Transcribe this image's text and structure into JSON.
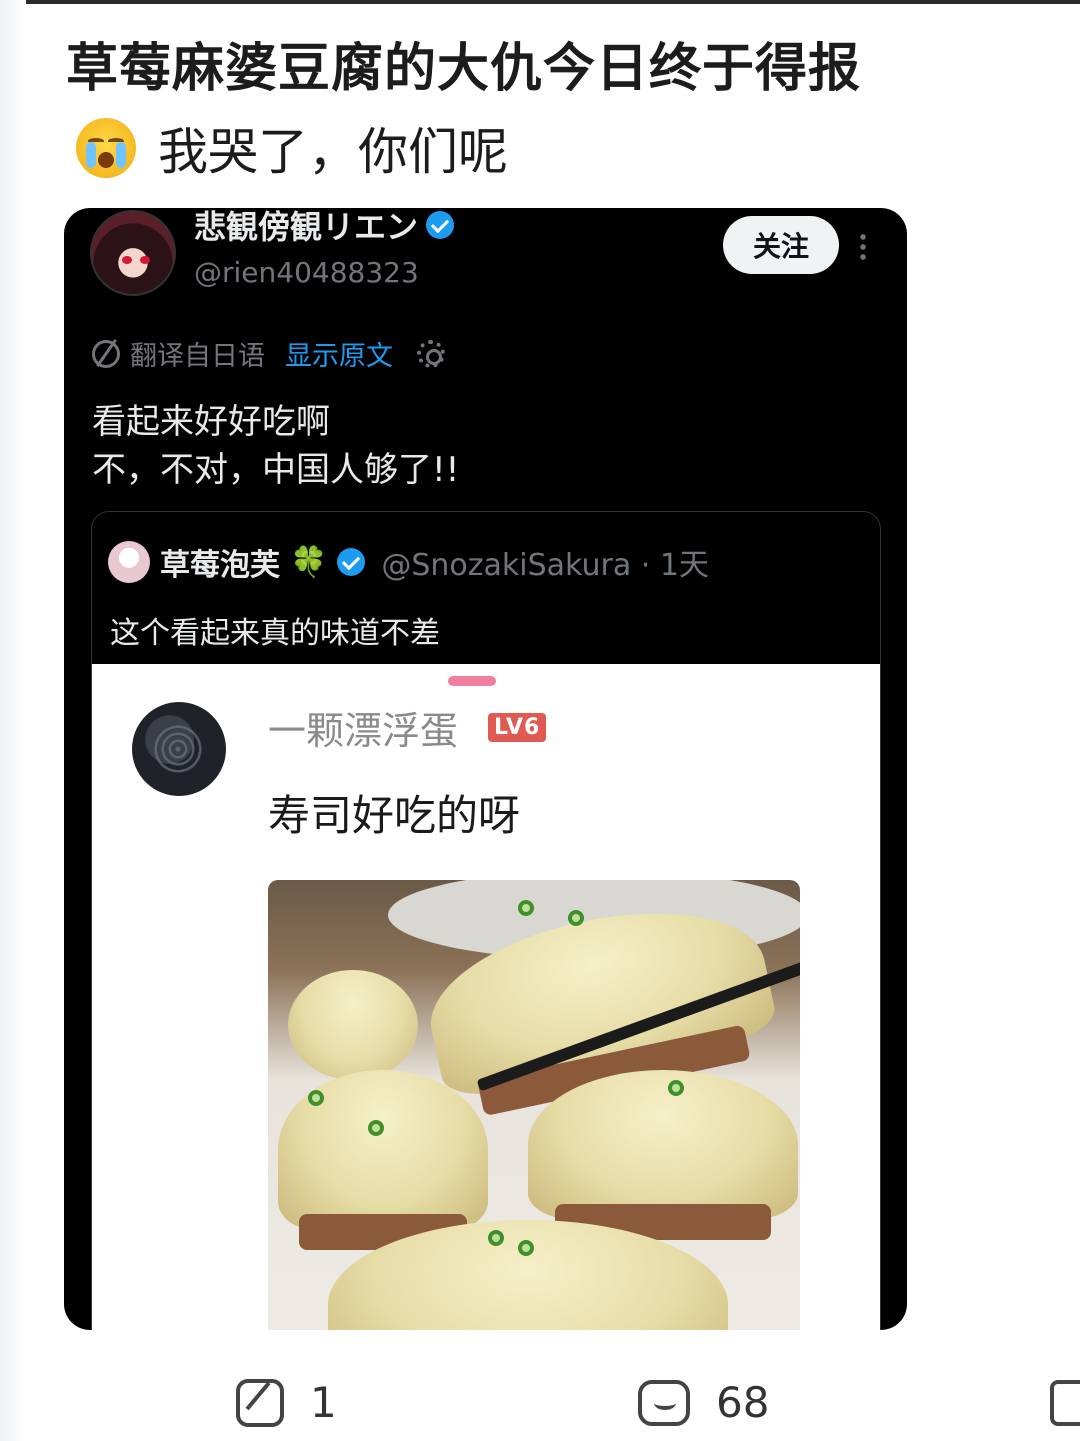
{
  "post": {
    "title": "草莓麻婆豆腐的大仇今日终于得报",
    "subtitle": "我哭了，你们呢"
  },
  "tweet": {
    "display_name": "悲観傍観リエン",
    "handle": "@rien40488323",
    "follow_label": "关注",
    "translate_label": "翻译自日语",
    "show_original_label": "显示原文",
    "text_line1": "看起来好好吃啊",
    "text_line2": "不，不对，中国人够了!!"
  },
  "quote": {
    "name": "草莓泡芙",
    "name_emoji": "🍀",
    "handle_time": "@SnozakiSakura · 1天",
    "text": "这个看起来真的味道不差"
  },
  "inner_post": {
    "username": "一颗漂浮蛋",
    "level": "LV6",
    "text": "寿司好吃的呀"
  },
  "actions": {
    "repost_count": "1",
    "comment_count": "68"
  },
  "colors": {
    "accent_blue": "#1d9bf0",
    "drag_handle_pink": "#f07fa0",
    "level_badge_red": "#e05a52"
  },
  "icons": [
    "crying-emoji-icon",
    "verified-badge-icon",
    "more-icon",
    "translate-icon",
    "gear-icon",
    "clover-icon",
    "repost-icon",
    "comment-icon",
    "like-icon"
  ]
}
